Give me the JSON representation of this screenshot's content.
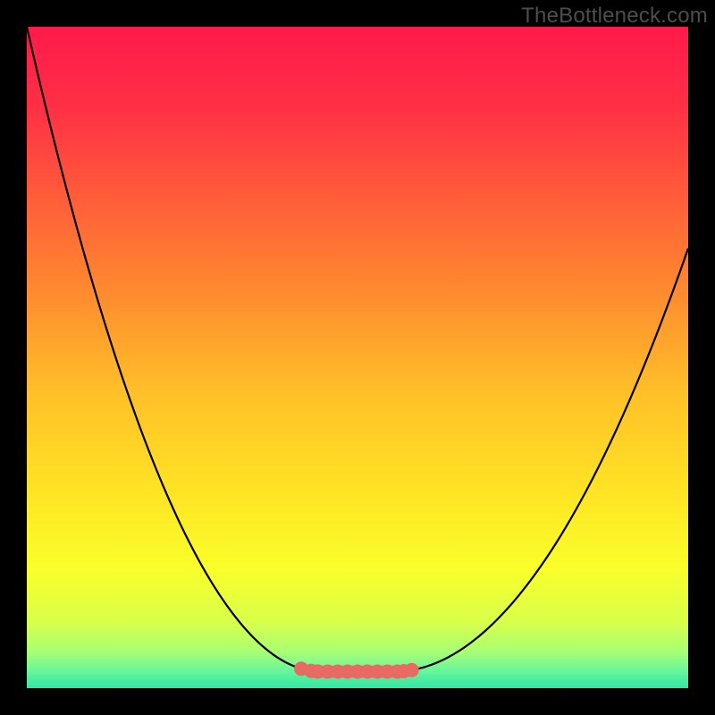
{
  "watermark": "TheBottleneck.com",
  "gradient": {
    "stops": [
      {
        "pos": 0.0,
        "color": "#ff1a4b"
      },
      {
        "pos": 0.12,
        "color": "#ff2f45"
      },
      {
        "pos": 0.25,
        "color": "#ff5a3a"
      },
      {
        "pos": 0.4,
        "color": "#ff8a2f"
      },
      {
        "pos": 0.55,
        "color": "#ffbf28"
      },
      {
        "pos": 0.7,
        "color": "#ffe324"
      },
      {
        "pos": 0.82,
        "color": "#f9ff2a"
      },
      {
        "pos": 0.9,
        "color": "#d8ff4a"
      },
      {
        "pos": 0.945,
        "color": "#a8ff74"
      },
      {
        "pos": 0.975,
        "color": "#66f59d"
      },
      {
        "pos": 1.0,
        "color": "#2fe7a2"
      }
    ]
  },
  "curve": {
    "stroke": "#000000",
    "width": 2.2,
    "left": {
      "x0": 0.0,
      "y0": 0.0,
      "xmin": 0.445
    },
    "right": {
      "x1": 1.0,
      "y1": 0.335,
      "xmin": 0.555
    },
    "flat_y": 0.975
  },
  "markers": {
    "color": "#e86a63",
    "radius": 8,
    "left_cluster": [
      0.415,
      0.43,
      0.44
    ],
    "right_cluster": [
      0.56,
      0.57,
      0.582
    ],
    "flat_points": [
      0.455,
      0.47,
      0.485,
      0.5,
      0.515,
      0.53,
      0.545
    ]
  },
  "chart_data": {
    "type": "line",
    "title": "",
    "xlabel": "",
    "ylabel": "",
    "xlim": [
      0,
      1
    ],
    "ylim": [
      0,
      1
    ],
    "note": "Axis-less bottleneck curve. x is normalized component ratio, y is normalized bottleneck severity (0 = top/red = worst, 1 = bottom/green = best). Values estimated from pixel positions.",
    "series": [
      {
        "name": "bottleneck-curve",
        "x": [
          0.0,
          0.05,
          0.1,
          0.15,
          0.2,
          0.25,
          0.3,
          0.35,
          0.4,
          0.445,
          0.5,
          0.555,
          0.6,
          0.65,
          0.7,
          0.75,
          0.8,
          0.85,
          0.9,
          0.95,
          1.0
        ],
        "y": [
          0.0,
          0.205,
          0.392,
          0.558,
          0.7,
          0.814,
          0.896,
          0.948,
          0.975,
          0.975,
          0.975,
          0.975,
          0.967,
          0.941,
          0.895,
          0.831,
          0.749,
          0.649,
          0.548,
          0.441,
          0.335
        ]
      },
      {
        "name": "optimal-markers",
        "x": [
          0.415,
          0.43,
          0.44,
          0.455,
          0.47,
          0.485,
          0.5,
          0.515,
          0.53,
          0.545,
          0.56,
          0.57,
          0.582
        ],
        "y": [
          0.92,
          0.945,
          0.962,
          0.975,
          0.975,
          0.975,
          0.975,
          0.975,
          0.975,
          0.975,
          0.962,
          0.947,
          0.926
        ]
      }
    ]
  }
}
